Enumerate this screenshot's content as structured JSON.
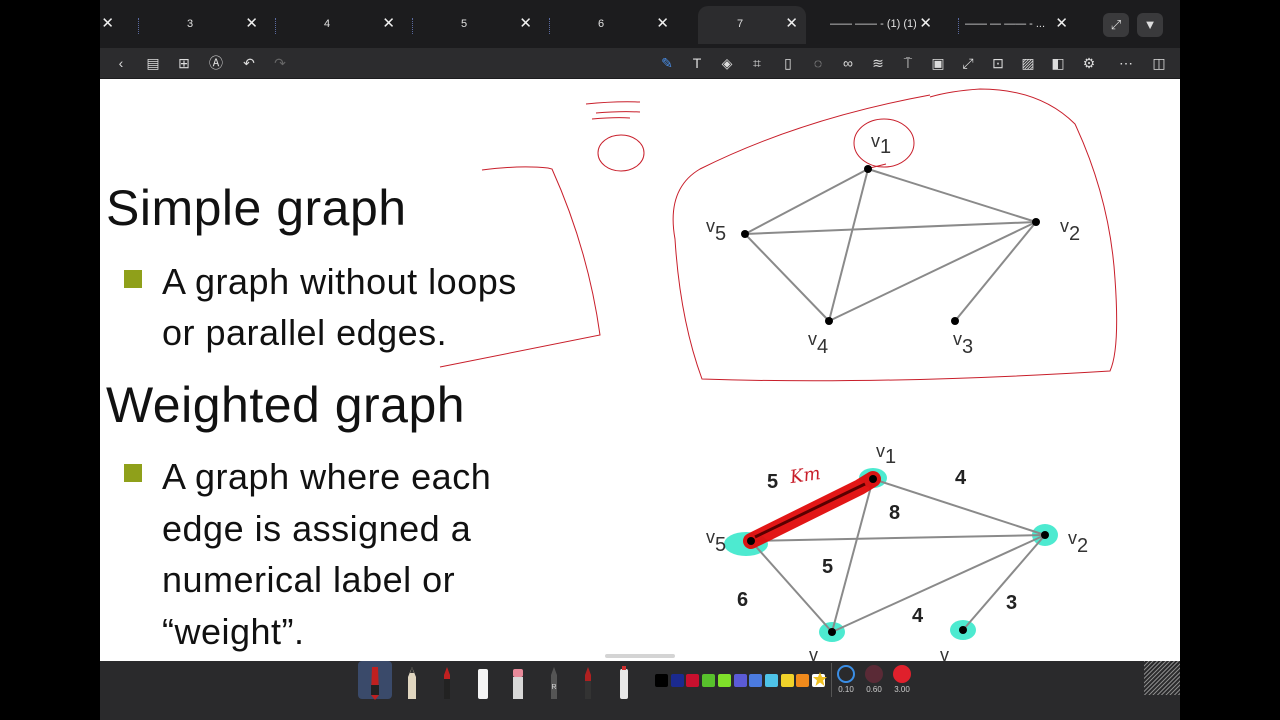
{
  "tabs": [
    {
      "label": "",
      "active": false
    },
    {
      "label": "3",
      "active": false
    },
    {
      "label": "4",
      "active": false
    },
    {
      "label": "5",
      "active": false
    },
    {
      "label": "6",
      "active": false
    },
    {
      "label": "7",
      "active": true
    },
    {
      "label": "—— —— - (1) (1)",
      "active": false
    },
    {
      "label": "—— — —— - ...",
      "active": false
    }
  ],
  "slide": {
    "heading1": "Simple graph",
    "bullet1_line1": "A graph without loops",
    "bullet1_line2": "or parallel edges.",
    "heading2": "Weighted graph",
    "bullet2_line1": "A graph where each",
    "bullet2_line2": "edge is assigned a",
    "bullet2_line3": "numerical label or",
    "bullet2_line4": "“weight”."
  },
  "graph1": {
    "vertices": [
      {
        "v": "v",
        "sub": "1"
      },
      {
        "v": "v",
        "sub": "2"
      },
      {
        "v": "v",
        "sub": "3"
      },
      {
        "v": "v",
        "sub": "4"
      },
      {
        "v": "v",
        "sub": "5"
      }
    ]
  },
  "graph2": {
    "vertices": [
      {
        "v": "v",
        "sub": "1"
      },
      {
        "v": "v",
        "sub": "2"
      },
      {
        "v": "v",
        "sub": ""
      },
      {
        "v": "v",
        "sub": ""
      },
      {
        "v": "v",
        "sub": "5"
      }
    ],
    "weights": [
      "5",
      "4",
      "8",
      "5",
      "6",
      "4",
      "3"
    ],
    "annotation": "Km"
  },
  "stroke_sizes": [
    {
      "label": "0.10",
      "color": "#3a8ee6"
    },
    {
      "label": "0.60",
      "color": "#5a2a36"
    },
    {
      "label": "3.00",
      "color": "#e0202c"
    }
  ],
  "palette": [
    "#000000",
    "#1b2a8f",
    "#c8102e",
    "#58c12c",
    "#7fe02a",
    "#5b5bd6",
    "#4b7be0",
    "#4ec3e8",
    "#f0d22a",
    "#f08a1c",
    "#ffffff"
  ],
  "colors": {
    "ink_red": "#c81e2a",
    "highlight_cyan": "#2ee6c8",
    "marker_red": "#e00a0a"
  }
}
